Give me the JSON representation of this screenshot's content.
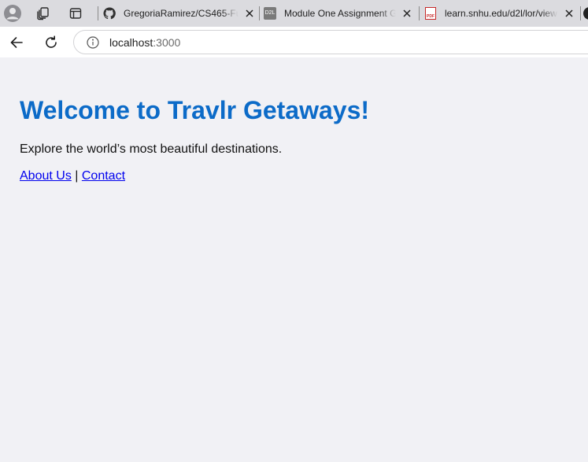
{
  "browser": {
    "tabs": [
      {
        "title": "GregoriaRamirez/CS465-Fu",
        "favicon": "github-icon"
      },
      {
        "title": "Module One Assignment G",
        "favicon": "d2l-icon"
      },
      {
        "title": "learn.snhu.edu/d2l/lor/view",
        "favicon": "pdf-icon"
      }
    ],
    "favicon_text": {
      "d2l": "D2L",
      "pdf": "PDF"
    },
    "address": {
      "host": "localhost",
      "port": ":3000"
    }
  },
  "page": {
    "heading": "Welcome to Travlr Getaways!",
    "intro": "Explore the world’s most beautiful destinations.",
    "links": {
      "about": "About Us",
      "separator": "|",
      "contact": "Contact"
    }
  },
  "colors": {
    "heading": "#0c6bc8",
    "link": "#0000ee",
    "page_background": "#f1f1f5",
    "tabstrip": "#dbdbdf"
  }
}
